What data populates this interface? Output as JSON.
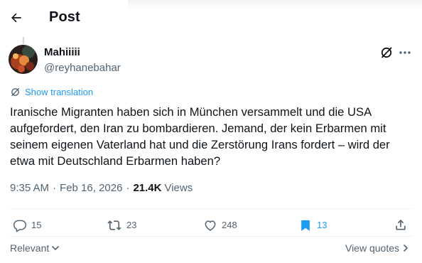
{
  "header": {
    "title": "Post",
    "back_icon": "arrow-left-icon"
  },
  "author": {
    "display_name": "Mahiiiii",
    "handle": "@reyhanebahar",
    "avatar_colors": [
      "#2a1d1a",
      "#c8502a",
      "#e58a3c"
    ]
  },
  "toolbar": {
    "grok_icon": "grok-icon",
    "more_icon": "more-horizontal-icon"
  },
  "translation": {
    "label": "Show translation",
    "icon": "translate-icon"
  },
  "tweet": {
    "text": "Iranische Migranten haben sich in München versammelt und die USA\naufgefordert, den Iran zu bombardieren. Jemand, der kein Erbarmen mit\nseinem eigenen Vaterland hat und die Zerstörung Irans fordert – wird der\netwa mit Deutschland Erbarmen haben?",
    "time": "9:35 AM",
    "separator": "·",
    "date": "Feb 16, 2026",
    "views_count": "21.4K",
    "views_label": "Views"
  },
  "actions": {
    "replies": "15",
    "reposts": "23",
    "likes": "248",
    "bookmarks": "13"
  },
  "footer": {
    "sort_label": "Relevant",
    "view_quotes_label": "View quotes"
  },
  "colors": {
    "text": "#0f1419",
    "secondary": "#536471",
    "accent": "#1d9bf0",
    "divider": "#eff3f4"
  }
}
